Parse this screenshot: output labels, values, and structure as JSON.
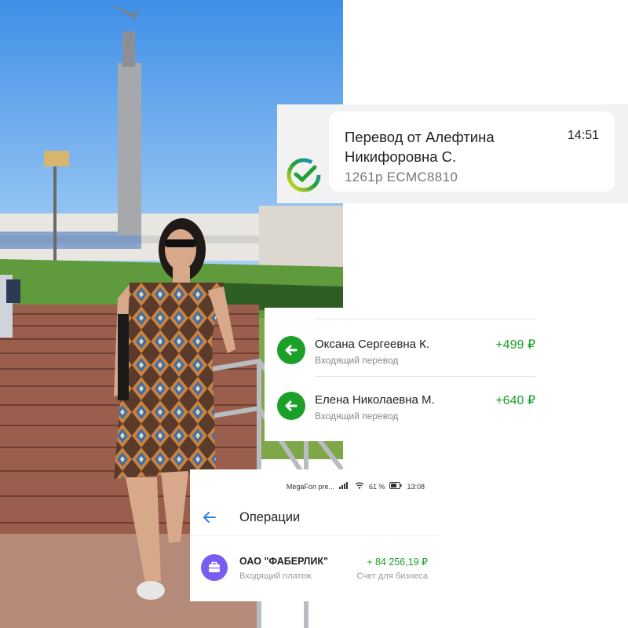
{
  "notification": {
    "title": "Перевод от Алефтина Никифоровна С.",
    "time": "14:51",
    "subtitle": "1261р ECMC8810",
    "logo_icon": "sber-logo-icon",
    "accent_color": "#21a038"
  },
  "transfers": [
    {
      "name": "Оксана Сергеевна К.",
      "type": "Входящий перевод",
      "amount": "+499 ₽",
      "icon": "arrow-left-icon"
    },
    {
      "name": "Елена Николаевна М.",
      "type": "Входящий перевод",
      "amount": "+640 ₽",
      "icon": "arrow-left-icon"
    }
  ],
  "operations_screen": {
    "status": {
      "carrier": "MegaFon pre...",
      "battery": "61 %",
      "time": "13:08"
    },
    "title": "Операции",
    "back_icon": "back-arrow-icon",
    "item": {
      "name": "ОАО \"ФАБЕРЛИК\"",
      "type": "Входящий платеж",
      "amount": "+ 84 256,19 ₽",
      "account": "Счет для бизнеса",
      "icon": "briefcase-icon"
    }
  },
  "colors": {
    "income_green": "#1a9f29",
    "back_blue": "#2f80ed",
    "merchant_purple": "#7b5cf0"
  }
}
